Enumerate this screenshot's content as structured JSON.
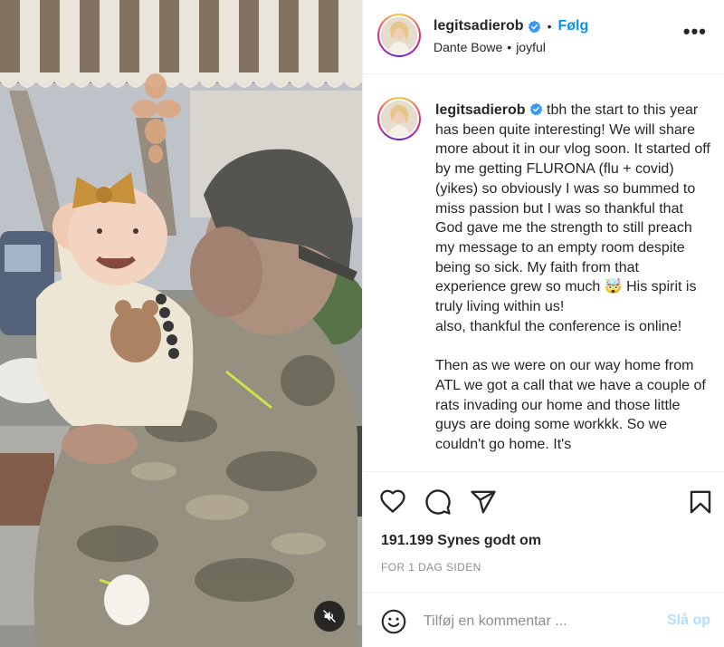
{
  "header": {
    "username": "legitsadierob",
    "follow_label": "Følg",
    "dot": "•",
    "audio_artist": "Dante Bowe",
    "audio_sep": "•",
    "audio_track": "joyful",
    "more_label": "•••"
  },
  "caption": {
    "username": "legitsadierob",
    "text": "tbh the start to this year has been quite interesting! We will share more about it in our vlog soon. It started off by me getting FLURONA (flu + covid) (yikes) so obviously I was so bummed to miss passion but I was so thankful that God gave me the strength to still preach my message to an empty room despite being so sick. My faith from that experience grew so much 🤯 His spirit is truly living within us!\nalso, thankful the conference is online!\n\nThen as we were on our way home from ATL we got a call that we have a couple of rats invading our home and those little guys are doing some workkk. So we couldn't go home. It's"
  },
  "icons": {
    "verified": "verified-badge-icon",
    "like": "heart-icon",
    "comment": "comment-bubble-icon",
    "share": "paper-plane-icon",
    "save": "bookmark-icon",
    "emoji": "smiley-icon",
    "mute": "speaker-muted-icon"
  },
  "stats": {
    "likes_text": "191.199 Synes godt om",
    "time_text": "FOR 1 DAG SIDEN"
  },
  "comment": {
    "placeholder": "Tilføj en kommentar ...",
    "post_label": "Slå op"
  },
  "colors": {
    "accent": "#0095f6",
    "post_disabled": "#b2dffc",
    "muted_text": "#8e8e8e",
    "verified": "#3897f0"
  }
}
